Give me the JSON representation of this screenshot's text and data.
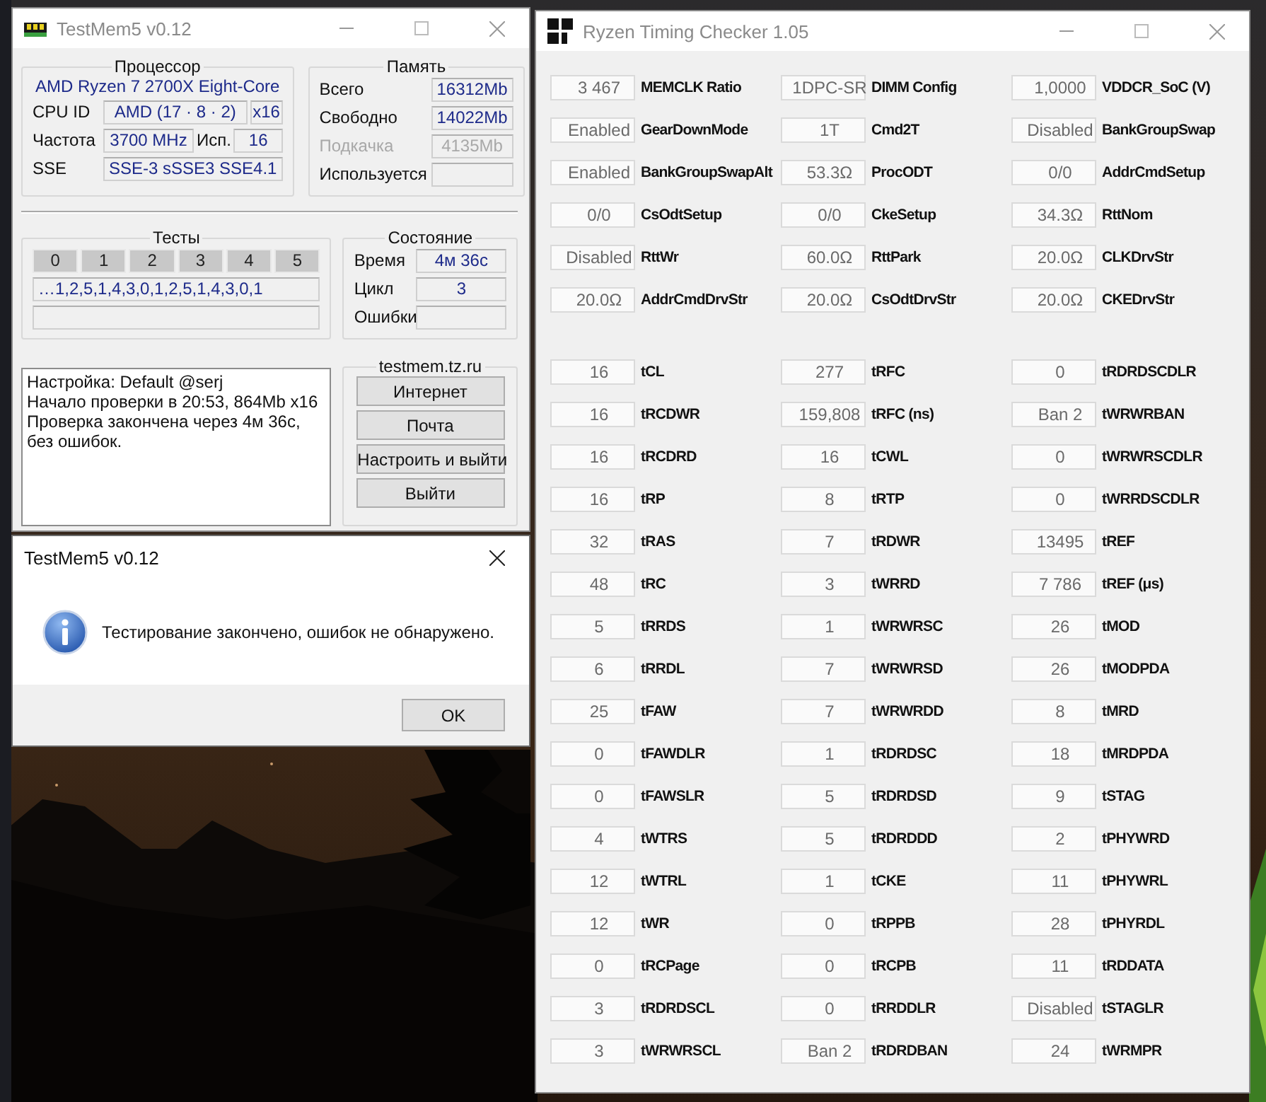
{
  "testmem": {
    "title": "TestMem5 v0.12",
    "processor": {
      "title": "Процессор",
      "cpu_name": "AMD Ryzen 7 2700X Eight-Core",
      "cpu_id_label": "CPU ID",
      "cpu_id": "AMD  (17 · 8 · 2)",
      "threads": "x16",
      "freq_label": "Частота",
      "freq": "3700 MHz",
      "used_label": "Исп.",
      "used": "16",
      "sse_label": "SSE",
      "sse": "SSE-3 sSSE3 SSE4.1"
    },
    "memory": {
      "title": "Память",
      "rows": [
        {
          "label": "Всего",
          "value": "16312Mb",
          "disabled": false
        },
        {
          "label": "Свободно",
          "value": "14022Mb",
          "disabled": false
        },
        {
          "label": "Подкачка",
          "value": "4135Mb",
          "disabled": true
        },
        {
          "label": "Используется",
          "disabled": false
        }
      ]
    },
    "tests": {
      "title": "Тесты",
      "numbers": [
        "0",
        "1",
        "2",
        "3",
        "4",
        "5"
      ],
      "sequence": "…1,2,5,1,4,3,0,1,2,5,1,4,3,0,1"
    },
    "status": {
      "title": "Состояние",
      "rows": [
        {
          "label": "Время",
          "value": "4м 36с"
        },
        {
          "label": "Цикл",
          "value": "3"
        },
        {
          "label": "Ошибки"
        }
      ]
    },
    "log": {
      "lines": [
        "Настройка: Default @serj",
        "Начало проверки в 20:53, 864Mb x16",
        "Проверка закончена через 4м 36с,",
        "без ошибок."
      ]
    },
    "links": {
      "title": "testmem.tz.ru",
      "buttons": [
        "Интернет",
        "Почта",
        "Настроить и выйти",
        "Выйти"
      ]
    }
  },
  "dialog": {
    "title": "TestMem5 v0.12",
    "message": "Тестирование закончено, ошибок не обнаружено.",
    "button": "OK"
  },
  "ryzen": {
    "title": "Ryzen Timing Checker 1.05",
    "sections": [
      {
        "items": [
          {
            "value": "3 467",
            "label": "MEMCLK Ratio"
          },
          {
            "value": "1DPC-SR",
            "label": "DIMM Config"
          },
          {
            "value": "1,0000",
            "label": "VDDCR_SoC (V)"
          },
          {
            "value": "Enabled",
            "label": "GearDownMode"
          },
          {
            "value": "1T",
            "label": "Cmd2T"
          },
          {
            "value": "Disabled",
            "label": "BankGroupSwap"
          },
          {
            "value": "Enabled",
            "label": "BankGroupSwapAlt"
          },
          {
            "value": "53.3Ω",
            "label": "ProcODT"
          },
          {
            "value": "0/0",
            "label": "AddrCmdSetup"
          },
          {
            "value": "0/0",
            "label": "CsOdtSetup"
          },
          {
            "value": "0/0",
            "label": "CkeSetup"
          },
          {
            "value": "34.3Ω",
            "label": "RttNom"
          },
          {
            "value": "Disabled",
            "label": "RttWr"
          },
          {
            "value": "60.0Ω",
            "label": "RttPark"
          },
          {
            "value": "20.0Ω",
            "label": "CLKDrvStr"
          },
          {
            "value": "20.0Ω",
            "label": "AddrCmdDrvStr"
          },
          {
            "value": "20.0Ω",
            "label": "CsOdtDrvStr"
          },
          {
            "value": "20.0Ω",
            "label": "CKEDrvStr"
          }
        ]
      },
      {
        "items": [
          {
            "value": "16",
            "label": "tCL"
          },
          {
            "value": "277",
            "label": "tRFC"
          },
          {
            "value": "0",
            "label": "tRDRDSCDLR"
          },
          {
            "value": "16",
            "label": "tRCDWR"
          },
          {
            "value": "159,808",
            "label": "tRFC (ns)"
          },
          {
            "value": "Ban 2",
            "label": "tWRWRBAN"
          },
          {
            "value": "16",
            "label": "tRCDRD"
          },
          {
            "value": "16",
            "label": "tCWL"
          },
          {
            "value": "0",
            "label": "tWRWRSCDLR"
          },
          {
            "value": "16",
            "label": "tRP"
          },
          {
            "value": "8",
            "label": "tRTP"
          },
          {
            "value": "0",
            "label": "tWRRDSCDLR"
          },
          {
            "value": "32",
            "label": "tRAS"
          },
          {
            "value": "7",
            "label": "tRDWR"
          },
          {
            "value": "13495",
            "label": "tREF"
          },
          {
            "value": "48",
            "label": "tRC"
          },
          {
            "value": "3",
            "label": "tWRRD"
          },
          {
            "value": "7 786",
            "label": "tREF (μs)"
          },
          {
            "value": "5",
            "label": "tRRDS"
          },
          {
            "value": "1",
            "label": "tWRWRSC"
          },
          {
            "value": "26",
            "label": "tMOD"
          },
          {
            "value": "6",
            "label": "tRRDL"
          },
          {
            "value": "7",
            "label": "tWRWRSD"
          },
          {
            "value": "26",
            "label": "tMODPDA"
          },
          {
            "value": "25",
            "label": "tFAW"
          },
          {
            "value": "7",
            "label": "tWRWRDD"
          },
          {
            "value": "8",
            "label": "tMRD"
          },
          {
            "value": "0",
            "label": "tFAWDLR"
          },
          {
            "value": "1",
            "label": "tRDRDSC"
          },
          {
            "value": "18",
            "label": "tMRDPDA"
          },
          {
            "value": "0",
            "label": "tFAWSLR"
          },
          {
            "value": "5",
            "label": "tRDRDSD"
          },
          {
            "value": "9",
            "label": "tSTAG"
          },
          {
            "value": "4",
            "label": "tWTRS"
          },
          {
            "value": "5",
            "label": "tRDRDDD"
          },
          {
            "value": "2",
            "label": "tPHYWRD"
          },
          {
            "value": "12",
            "label": "tWTRL"
          },
          {
            "value": "1",
            "label": "tCKE"
          },
          {
            "value": "11",
            "label": "tPHYWRL"
          },
          {
            "value": "12",
            "label": "tWR"
          },
          {
            "value": "0",
            "label": "tRPPB"
          },
          {
            "value": "28",
            "label": "tPHYRDL"
          },
          {
            "value": "0",
            "label": "tRCPage"
          },
          {
            "value": "0",
            "label": "tRCPB"
          },
          {
            "value": "11",
            "label": "tRDDATA"
          },
          {
            "value": "3",
            "label": "tRDRDSCL"
          },
          {
            "value": "0",
            "label": "tRRDDLR"
          },
          {
            "value": "Disabled",
            "label": "tSTAGLR"
          },
          {
            "value": "3",
            "label": "tWRWRSCL"
          },
          {
            "value": "Ban 2",
            "label": "tRDRDBAN"
          },
          {
            "value": "24",
            "label": "tWRMPR"
          }
        ]
      }
    ]
  }
}
